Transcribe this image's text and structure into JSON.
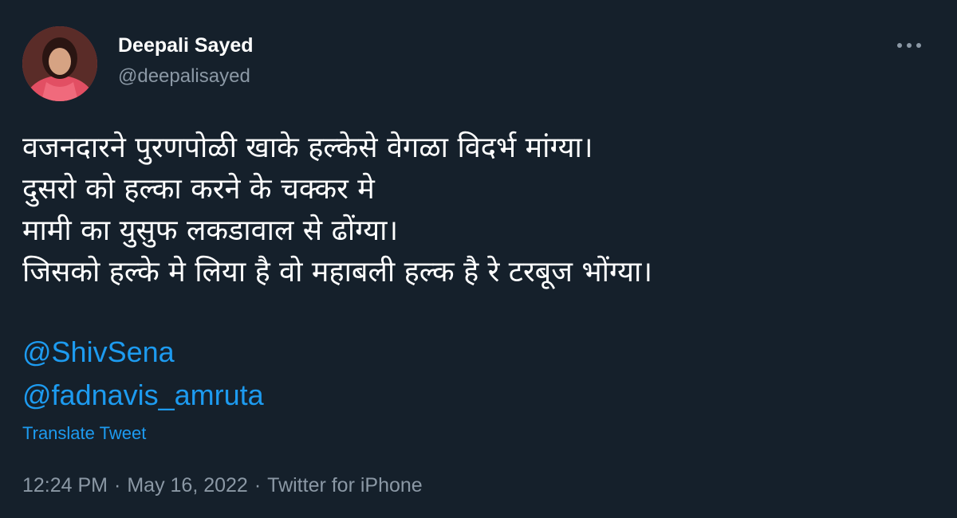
{
  "author": {
    "display_name": "Deepali Sayed",
    "handle": "@deepalisayed",
    "avatar": "profile-photo"
  },
  "tweet": {
    "lines": [
      "वजनदारने पुरणपोळी खाके हल्केसे वेगळा विदर्भ मांग्या।",
      "दुसरो को हल्का करने के चक्कर मे",
      "मामी का युसुफ लकडावाल से ढोंग्या।",
      "जिसको हल्के मे लिया है वो महाबली हल्क है रे टरबूज भोंग्या।"
    ],
    "mentions": [
      "@ShivSena",
      "@fadnavis_amruta"
    ],
    "translate_label": "Translate Tweet"
  },
  "meta": {
    "time": "12:24 PM",
    "date": "May 16, 2022",
    "source": "Twitter for iPhone",
    "separator": "·"
  },
  "icons": {
    "more": "more-horizontal-icon"
  },
  "colors": {
    "background": "#15202b",
    "link": "#1d9bf0",
    "secondary_text": "#8b98a5",
    "primary_text": "#ffffff"
  }
}
